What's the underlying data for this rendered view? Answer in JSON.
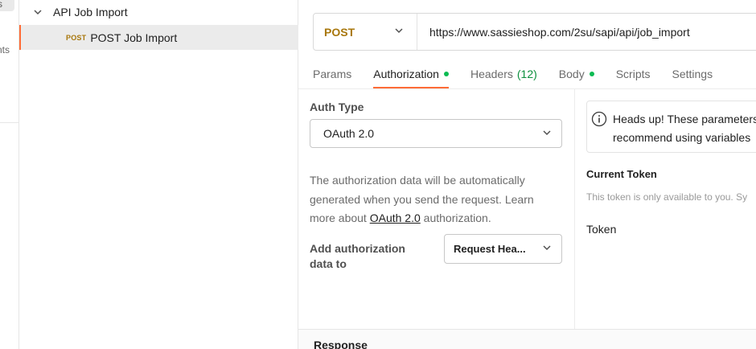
{
  "rail": {
    "top_label": "s",
    "partial_label": "nts"
  },
  "sidebar": {
    "folder": {
      "label": "API Job Import",
      "icon": "chevron-down-icon"
    },
    "request": {
      "method_tag": "POST",
      "label": "POST Job Import"
    }
  },
  "request": {
    "method": "POST",
    "url": "https://www.sassieshop.com/2su/sapi/api/job_import"
  },
  "tabs": [
    {
      "label": "Params"
    },
    {
      "label": "Authorization",
      "dot": true,
      "active": true
    },
    {
      "label": "Headers",
      "count": "(12)"
    },
    {
      "label": "Body",
      "dot": true
    },
    {
      "label": "Scripts"
    },
    {
      "label": "Settings"
    }
  ],
  "auth": {
    "type_label": "Auth Type",
    "type_value": "OAuth 2.0",
    "description_pre": "The authorization data will be automatically generated when you send the request. Learn more about ",
    "description_link": "OAuth 2.0",
    "description_post": " authorization.",
    "add_to_label": "Add authorization data to",
    "add_to_value": "Request Hea..."
  },
  "notice": {
    "icon": "info-icon",
    "line1": "Heads up! These parameters",
    "line2": "recommend using variables"
  },
  "token": {
    "section_title": "Current Token",
    "hint": "This token is only available to you. Sy",
    "label": "Token"
  },
  "response": {
    "label": "Response"
  },
  "colors": {
    "accent": "#ff6c37",
    "post_method": "#a8770c",
    "status_dot": "#0cbb52"
  }
}
